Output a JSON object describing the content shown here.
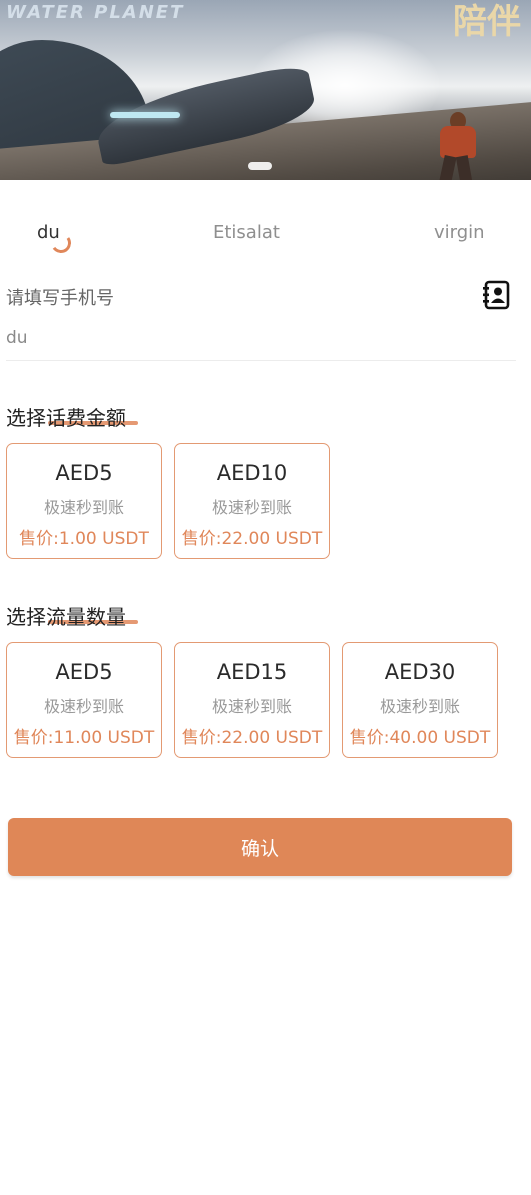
{
  "banner": {
    "logo_left": "WATER PLANET",
    "logo_right": "陪伴"
  },
  "operators": {
    "tabs": [
      {
        "label": "du",
        "active": true
      },
      {
        "label": "Etisalat",
        "active": false
      },
      {
        "label": "virgin",
        "active": false
      }
    ]
  },
  "phone": {
    "label": "请填写手机号",
    "value": "du",
    "contact_icon": "contacts-book-icon"
  },
  "recharge": {
    "title": "选择话费金额",
    "cards": [
      {
        "name": "AED5",
        "desc": "极速秒到账",
        "price": "售价:1.00 USDT"
      },
      {
        "name": "AED10",
        "desc": "极速秒到账",
        "price": "售价:22.00 USDT"
      }
    ]
  },
  "data_plan": {
    "title": "选择流量数量",
    "cards": [
      {
        "name": "AED5",
        "desc": "极速秒到账",
        "price": "售价:11.00 USDT"
      },
      {
        "name": "AED15",
        "desc": "极速秒到账",
        "price": "售价:22.00 USDT"
      },
      {
        "name": "AED30",
        "desc": "极速秒到账",
        "price": "售价:40.00 USDT"
      }
    ]
  },
  "confirm_label": "确认",
  "colors": {
    "accent": "#e0875a",
    "card_border": "#e39a73",
    "button": "#df8757"
  }
}
